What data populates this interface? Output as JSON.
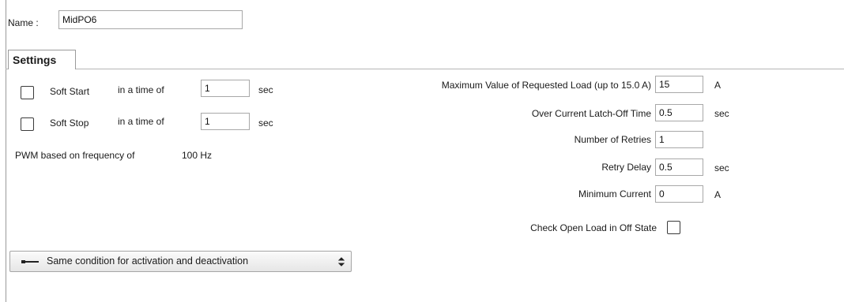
{
  "name": {
    "label": "Name :",
    "value": "MidPO6"
  },
  "tab": {
    "label": "Settings"
  },
  "left": {
    "soft_start": {
      "label": "Soft Start",
      "time_label": "in a time of",
      "value": "1",
      "unit": "sec",
      "checked": false
    },
    "soft_stop": {
      "label": "Soft Stop",
      "time_label": "in a time of",
      "value": "1",
      "unit": "sec",
      "checked": false
    },
    "pwm_text": "PWM based on frequency of",
    "pwm_value": "100 Hz"
  },
  "right": {
    "max_load": {
      "label": "Maximum Value of Requested Load  (up to 15.0 A)",
      "value": "15",
      "unit": "A"
    },
    "latch_off": {
      "label": "Over Current Latch-Off Time",
      "value": "0.5",
      "unit": "sec"
    },
    "retries": {
      "label": "Number of Retries",
      "value": "1"
    },
    "retry_delay": {
      "label": "Retry Delay",
      "value": "0.5",
      "unit": "sec"
    },
    "min_current": {
      "label": "Minimum Current",
      "value": "0",
      "unit": "A"
    },
    "open_load": {
      "label": "Check Open Load in Off State",
      "checked": false
    }
  },
  "dropdown": {
    "label": "Same condition for activation and deactivation",
    "icon": "line-connector-icon"
  },
  "colors": {
    "border": "#a8a8a8",
    "tab_border": "#9a9a9a",
    "text": "#1a1a1a"
  }
}
